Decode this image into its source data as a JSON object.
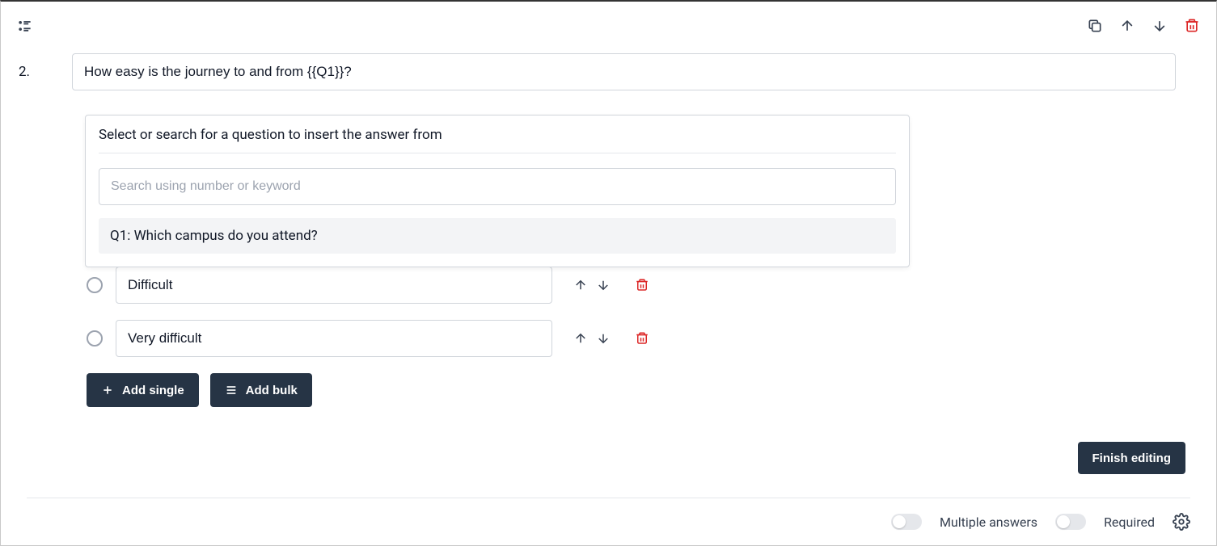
{
  "question": {
    "number": "2.",
    "text": "How easy is the journey to and from {{Q1}}?"
  },
  "dropdown": {
    "title": "Select or search for a question to insert the answer from",
    "search_placeholder": "Search using number or keyword",
    "results": [
      {
        "label": "Q1: Which campus do you attend?"
      }
    ]
  },
  "options": [
    {
      "label": "Difficult"
    },
    {
      "label": "Very difficult"
    }
  ],
  "buttons": {
    "add_single": "Add single",
    "add_bulk": "Add bulk",
    "finish": "Finish editing"
  },
  "footer": {
    "multiple_answers": "Multiple answers",
    "required": "Required"
  }
}
